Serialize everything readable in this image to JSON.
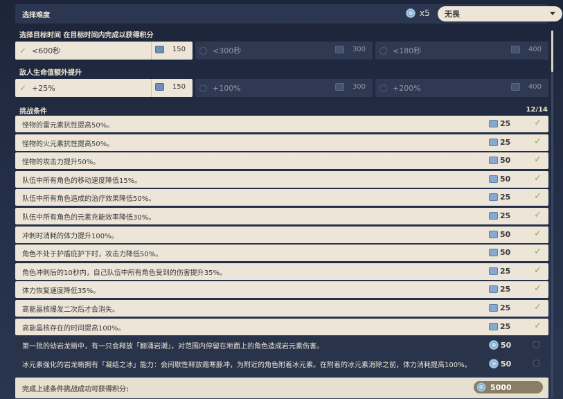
{
  "difficulty": {
    "label": "选择难度",
    "count": "x5",
    "selected": "无畏"
  },
  "time": {
    "title": "选择目标时间 在目标时间内完成以获得积分",
    "options": [
      {
        "label": "<600秒",
        "points": "150",
        "selected": true
      },
      {
        "label": "<300秒",
        "points": "300",
        "selected": false
      },
      {
        "label": "<180秒",
        "points": "400",
        "selected": false
      }
    ]
  },
  "hp": {
    "title": "敌人生命值额外提升",
    "options": [
      {
        "label": "+25%",
        "points": "150",
        "selected": true
      },
      {
        "label": "+100%",
        "points": "300",
        "selected": false
      },
      {
        "label": "+200%",
        "points": "400",
        "selected": false
      }
    ]
  },
  "conditions": {
    "title": "挑战条件",
    "count": "12/14",
    "items": [
      {
        "text": "怪物的雷元素抗性提高50%。",
        "points": "25",
        "selected": true
      },
      {
        "text": "怪物的火元素抗性提高50%。",
        "points": "25",
        "selected": true
      },
      {
        "text": "怪物的攻击力提升50%。",
        "points": "50",
        "selected": true
      },
      {
        "text": "队伍中所有角色的移动速度降低15%。",
        "points": "50",
        "selected": true
      },
      {
        "text": "队伍中所有角色造成的治疗效果降低50%。",
        "points": "25",
        "selected": true
      },
      {
        "text": "队伍中所有角色的元素充能效率降低30%。",
        "points": "25",
        "selected": true
      },
      {
        "text": "冲刺时消耗的体力提升100%。",
        "points": "50",
        "selected": true
      },
      {
        "text": "角色不处于护盾庇护下时，攻击力降低50%。",
        "points": "50",
        "selected": true
      },
      {
        "text": "角色冲刺后的10秒内，自己队伍中所有角色受到的伤害提升35%。",
        "points": "25",
        "selected": true
      },
      {
        "text": "体力恢复速度降低35%。",
        "points": "25",
        "selected": true
      },
      {
        "text": "高能晶核爆发二次后才会消失。",
        "points": "25",
        "selected": true
      },
      {
        "text": "高能晶核存在的时间提高100%。",
        "points": "25",
        "selected": true
      },
      {
        "text": "第一批的幼岩龙蜥中，有一只会释放「翻涌岩潮」，对范围内停留在地面上的角色造成岩元素伤害。",
        "points": "50",
        "selected": false
      },
      {
        "text": "冰元素强化的岩龙蜥拥有「凝结之冰」能力：会间歇性释放霜寒脉冲，为附近的角色附着冰元素。在附着的冰元素消除之前，体力消耗提高100%。",
        "points": "50",
        "selected": false
      }
    ]
  },
  "footer": {
    "label": "完成上述条件挑战成功可获得积分:",
    "score": "5000"
  }
}
